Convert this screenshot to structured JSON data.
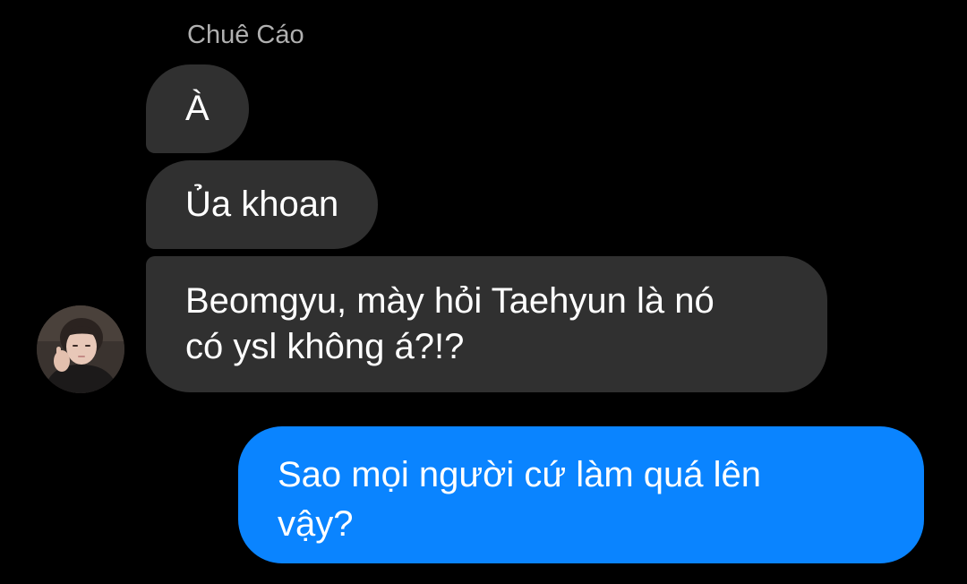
{
  "conversation": {
    "sender_name": "Chuê Cáo",
    "incoming": [
      {
        "lines": [
          "À"
        ]
      },
      {
        "lines": [
          "Ủa khoan"
        ]
      },
      {
        "lines": [
          "Beomgyu, mày hỏi Taehyun là nó",
          "có ysl không á?!?"
        ]
      }
    ],
    "outgoing": [
      {
        "lines": [
          "Sao mọi người cứ làm quá lên",
          "vậy?"
        ]
      }
    ]
  },
  "colors": {
    "background": "#000000",
    "incoming_bubble": "#303030",
    "outgoing_bubble": "#0a84ff",
    "sender_name": "#b0b0b0"
  },
  "icons": {
    "avatar": "profile-photo"
  }
}
